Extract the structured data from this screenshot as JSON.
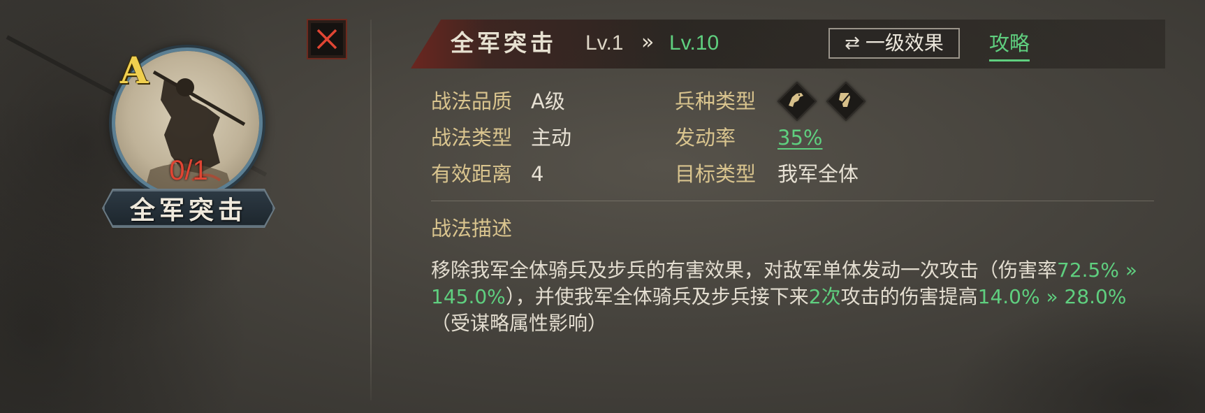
{
  "skill": {
    "name": "全军突击",
    "grade_badge": "A",
    "count": "0/1"
  },
  "header": {
    "title": "全军突击",
    "level_from": "Lv.1",
    "level_arrow": "»",
    "level_to": "Lv.10",
    "effect_button_icon": "⇄",
    "effect_button_label": "一级效果",
    "guide_link": "攻略"
  },
  "attributes": {
    "quality_label": "战法品质",
    "quality_value": "A级",
    "type_label": "战法类型",
    "type_value": "主动",
    "distance_label": "有效距离",
    "distance_value": "4",
    "troop_label": "兵种类型",
    "troop_icons": [
      "cavalry-icon",
      "infantry-icon"
    ],
    "rate_label": "发动率",
    "rate_value": "35%",
    "target_label": "目标类型",
    "target_value": "我军全体"
  },
  "description": {
    "title": "战法描述",
    "seg1": "移除我军全体骑兵及步兵的有害效果，对敌军单体发动一次攻击（伤害率",
    "seg2": "72.5% » 145.0%",
    "seg3": "），并使我军全体骑兵及步兵接下来",
    "seg4": "2次",
    "seg5": "攻击的伤害提高",
    "seg6": "14.0% » 28.0%",
    "seg7": "（受谋略属性影响）"
  },
  "colors": {
    "highlight_green": "#5fcf7f",
    "label_gold": "#d9c48e",
    "count_red": "#e04533",
    "grade_yellow": "#f0cf4f"
  }
}
